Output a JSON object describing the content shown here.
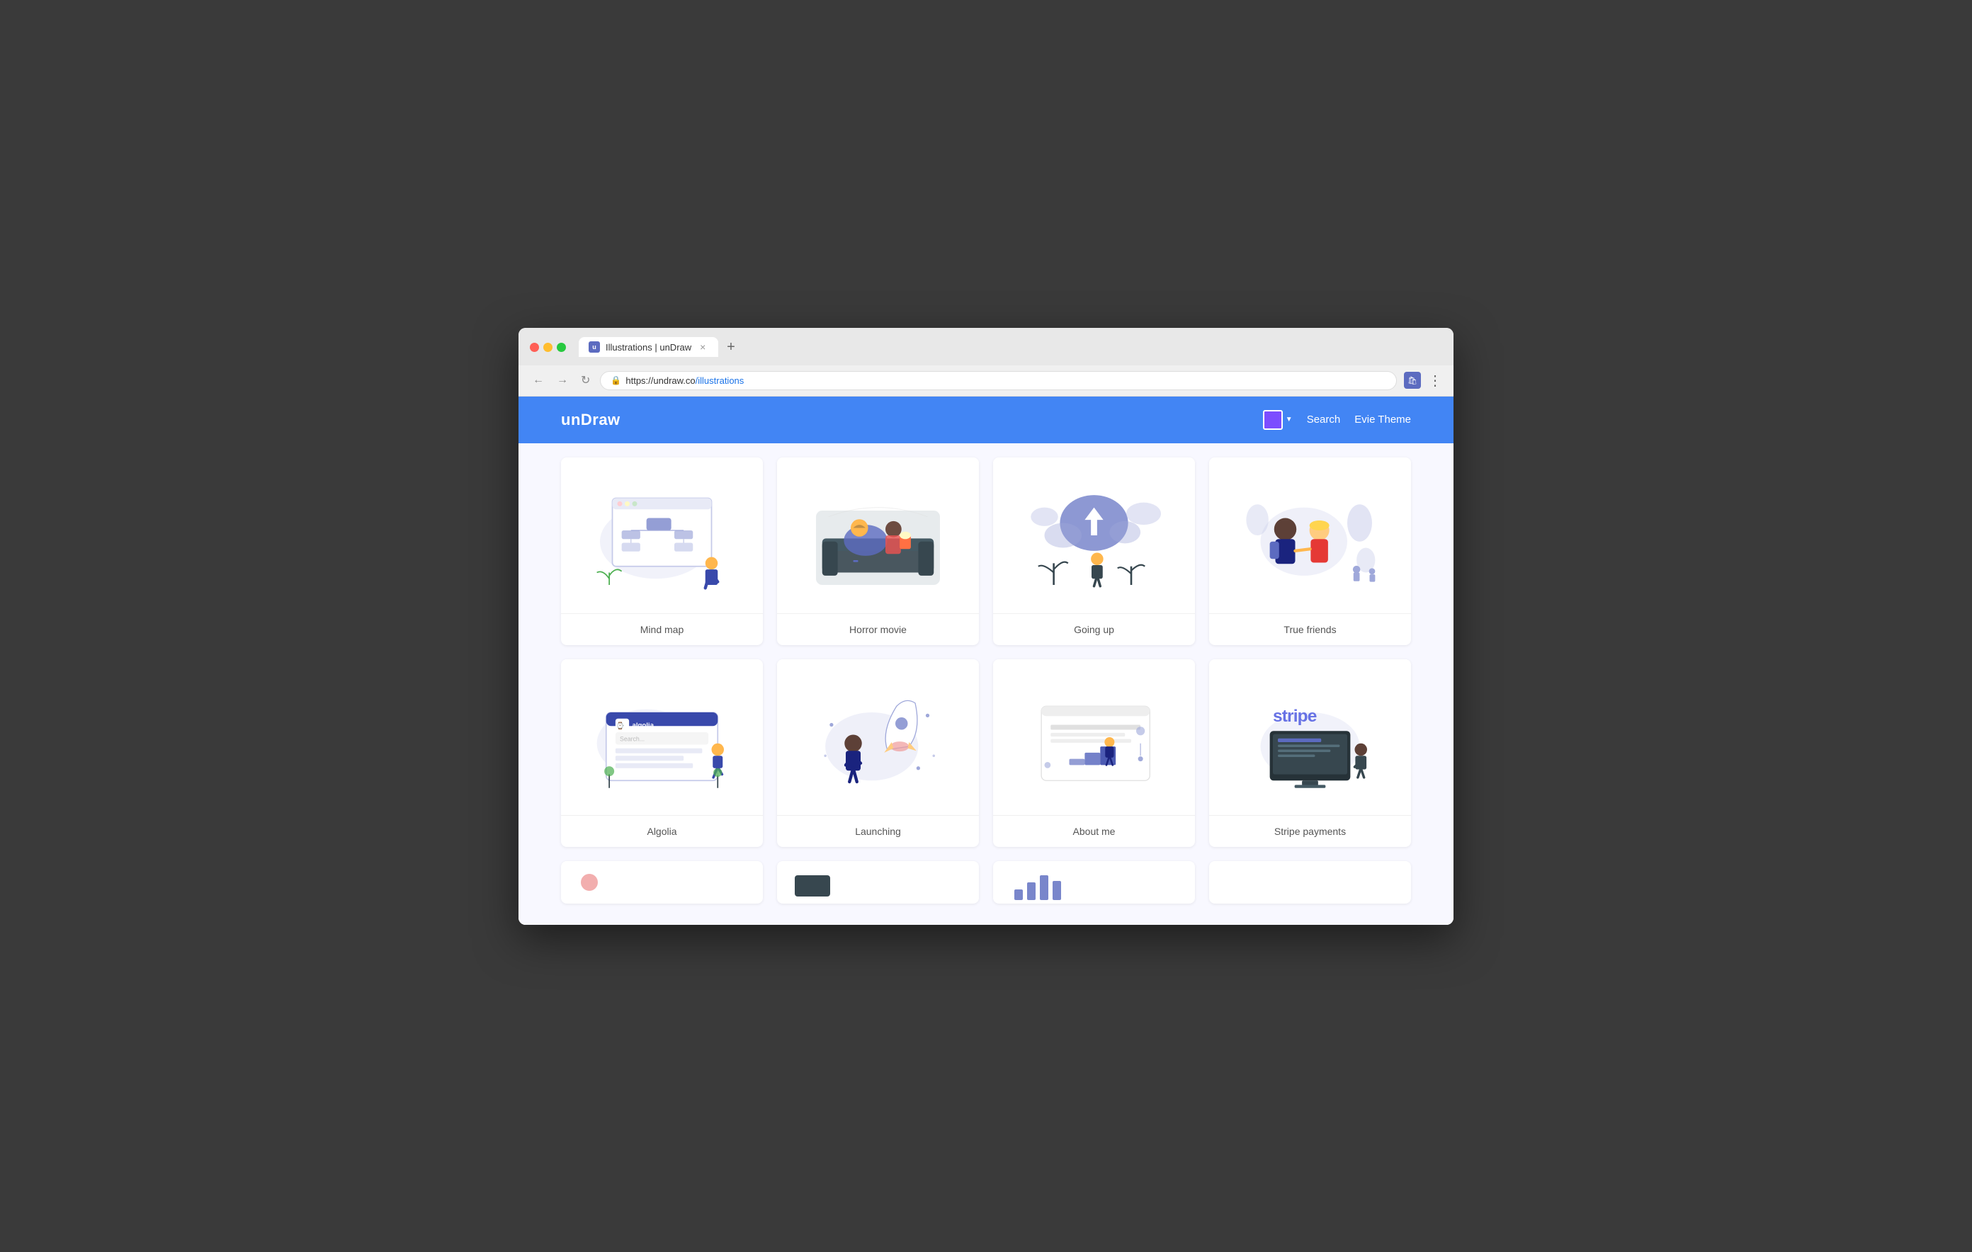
{
  "browser": {
    "tab_title": "Illustrations | unDraw",
    "tab_favicon_text": "u",
    "url": "https://undraw.co/illustrations",
    "url_domain": "undraw.co",
    "url_path": "/illustrations",
    "close_label": "×",
    "new_tab_label": "+"
  },
  "nav": {
    "logo": "unDraw",
    "color_label": "Color picker",
    "search_label": "Search",
    "theme_label": "Evie Theme",
    "accent_color": "#7c4dff"
  },
  "illustrations": [
    {
      "id": "mind-map",
      "label": "Mind map",
      "row": 1
    },
    {
      "id": "horror-movie",
      "label": "Horror movie",
      "row": 1
    },
    {
      "id": "going-up",
      "label": "Going up",
      "row": 1
    },
    {
      "id": "true-friends",
      "label": "True friends",
      "row": 1
    },
    {
      "id": "algolia",
      "label": "Algolia",
      "row": 2
    },
    {
      "id": "launching",
      "label": "Launching",
      "row": 2
    },
    {
      "id": "about-me",
      "label": "About me",
      "row": 2
    },
    {
      "id": "stripe-payments",
      "label": "Stripe payments",
      "row": 2
    }
  ]
}
